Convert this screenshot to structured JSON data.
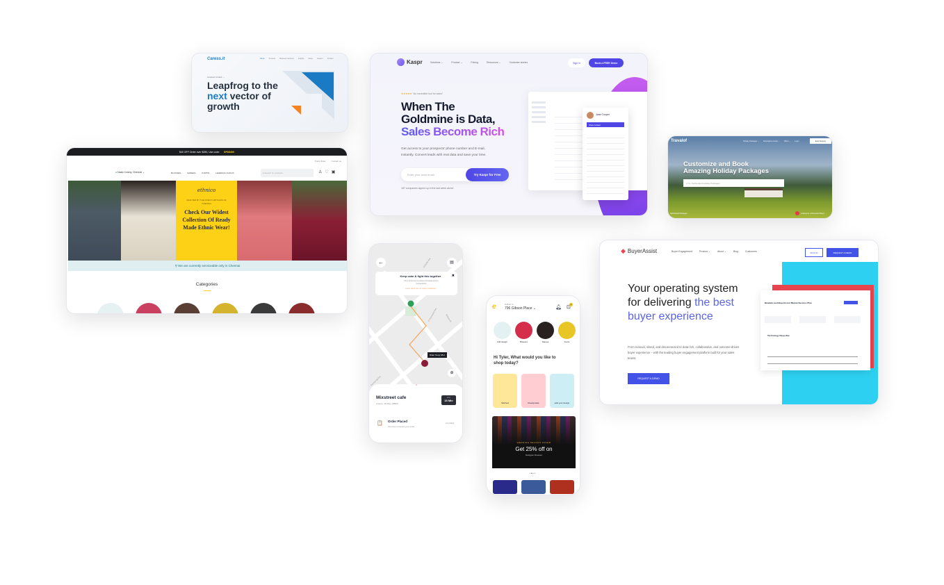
{
  "caress": {
    "logo": "Caress.it",
    "nav": [
      "Home",
      "Services",
      "Business Services",
      "Insights",
      "About",
      "Careers",
      "Contact"
    ],
    "kicker": "Connect to Next →",
    "headline_1": "Leapfrog to the",
    "headline_accent": "next",
    "headline_2": "vector of",
    "headline_3": "growth",
    "accent": "#1a7bc4",
    "orange": "#f58220"
  },
  "kaspr": {
    "logo": "Kaspr",
    "nav": [
      "Solutions ⌄",
      "Product ⌄",
      "Pricing",
      "Resources ⌄",
      "Customer stories"
    ],
    "sign_in": "Sign in",
    "demo": "Book a FREE Demo",
    "rating": "★★★★★",
    "quote": "\"An incredible tool for sales\"",
    "h1": "When The",
    "h2": "Goldmine is Data,",
    "h3": "Sales Become Rich",
    "sub_1": "Get access to your prospects' phone number and E-mail,",
    "sub_2": "instantly. Convert leads with real data and save your time.",
    "email_placeholder": "Enter your work email",
    "cta": "Try Kaspr for Free",
    "signup": "187 companies signed up in the last week alone!",
    "contact_name": "Jane Cooper",
    "contact_btn": "Show contact",
    "accent": "#4f46e5"
  },
  "ethnic": {
    "promo": "$40 OFF Order over $250, Use code:",
    "code": "SPD8400",
    "track": "Track Order",
    "contact": "Contact us",
    "location": "Nadu Colony, Chennai ⌄",
    "nav": [
      "BLOUSES",
      "SAREES",
      "KURTIS",
      "LEHENGA CHOLIS"
    ],
    "search_placeholder": "Search for products",
    "brand": "ethnico",
    "crafted": "CRAFTED BY THE FINEST ARTISANS OF CHENNAI",
    "banner": "Check Our Widest Collection Of Ready Made Ethnic Wear!",
    "notice": "We are currently serviceable only in Chennai",
    "categories": "Categories",
    "yellow": "#fcd116"
  },
  "travalof": {
    "logo": "Travalof",
    "nav": [
      "Holiday Packages ⌄",
      "Destinations Guide ⌄",
      "Offers ⌄",
      "Login"
    ],
    "cta": "Enter Enquiry",
    "h1": "Customize and Book",
    "h2": "Amazing Holiday Packages",
    "search_placeholder": "Try 'Switzerland Holiday Packages'",
    "caption": "Switzerland Packages",
    "badge": "Looking for a Romantic Place?"
  },
  "map_app": {
    "banner_title": "Keep calm & fight this together",
    "banner_text": "Do's & Don'ts to protect Ourselves from Coronavirus",
    "banner_link": "Learn about all our safety initiatives",
    "streets": [
      "Orlando Ave",
      "E Fernwood Ave",
      "Fernwood Ave",
      "Boleyn Pl"
    ],
    "rider_temp": "Rider Temp 98.2",
    "cafe": "Mixstreet cafe",
    "order_meta": "2 items, 15 May, Q8500",
    "eta_label": "ETA",
    "eta": "15 Min",
    "status": "Order Placed",
    "status_text": "We have recieved your order.",
    "time": "10:20AM"
  },
  "shop_app": {
    "deliver_to": "Deliver to",
    "address": "796 Gibson Place ⌄",
    "cart_count": "2",
    "categories": [
      "Add design",
      "Blouses",
      "Sarees",
      "Kurtis"
    ],
    "greeting": "Hi Tyler, What would you like to shop today?",
    "tiles": [
      "Stitched",
      "Readymade",
      "Add your design"
    ],
    "offer_kicker": "WEDDING SEASON OFFER",
    "offer": "Get 25% off on",
    "offer_sub": "Designer Dresses"
  },
  "buyer": {
    "logo": "BuyerAssist",
    "nav": [
      "Buyer Engagement",
      "Product ⌄",
      "About ⌄",
      "Blog",
      "Customers"
    ],
    "sign_in": "SIGN IN",
    "demo": "REQUEST A DEMO",
    "h1": "Your operating system for delivering",
    "h2": "the best buyer experience",
    "sub": "From manual, siloed, and disconnected to data-rich, collaborative, and outcome-driven buyer experience – with the leading buyer engagement platform built for your sales teams.",
    "cta": "REQUEST A DEMO",
    "plan_title": "Bluelabs and BuyerAssist Mutual Success Plan",
    "section": "Technology Deep-dive",
    "accent": "#4353e8",
    "cyan": "#2dd0f0",
    "red": "#e8454f"
  }
}
